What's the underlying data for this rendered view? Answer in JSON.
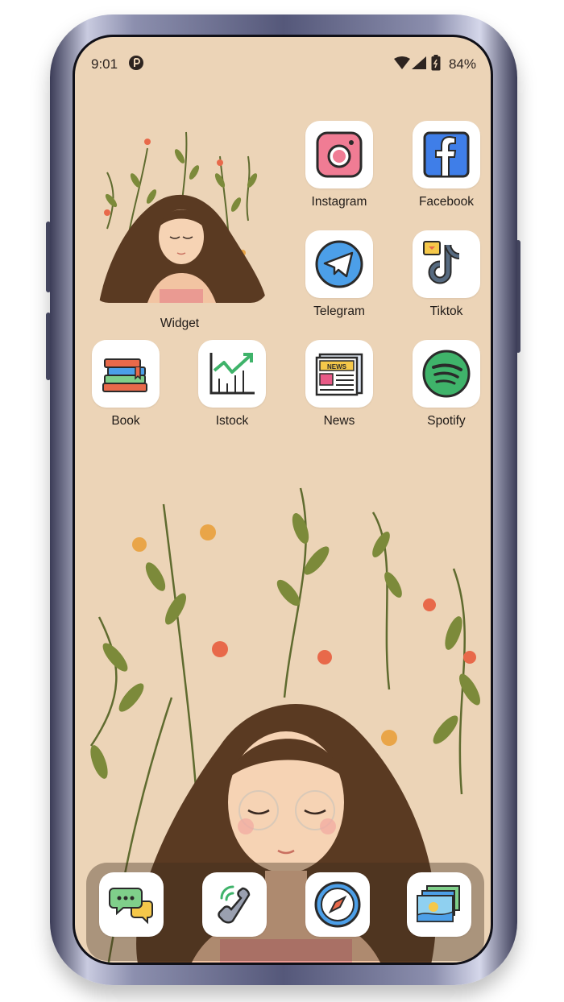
{
  "status_bar": {
    "time": "9:01",
    "battery": "84%"
  },
  "widget": {
    "label": "Widget"
  },
  "apps": [
    {
      "label": "Instagram",
      "icon": "instagram-icon"
    },
    {
      "label": "Facebook",
      "icon": "facebook-icon"
    },
    {
      "label": "Telegram",
      "icon": "telegram-icon"
    },
    {
      "label": "Tiktok",
      "icon": "tiktok-icon"
    },
    {
      "label": "Book",
      "icon": "book-icon"
    },
    {
      "label": "Istock",
      "icon": "stock-chart-icon"
    },
    {
      "label": "News",
      "icon": "news-icon"
    },
    {
      "label": "Spotify",
      "icon": "spotify-icon"
    }
  ],
  "dock": [
    {
      "icon": "messages-icon"
    },
    {
      "icon": "phone-icon"
    },
    {
      "icon": "compass-icon"
    },
    {
      "icon": "photos-icon"
    }
  ],
  "colors": {
    "wallpaper": "#ecd4b7",
    "tile": "#ffffff",
    "text": "#1f1a17"
  }
}
